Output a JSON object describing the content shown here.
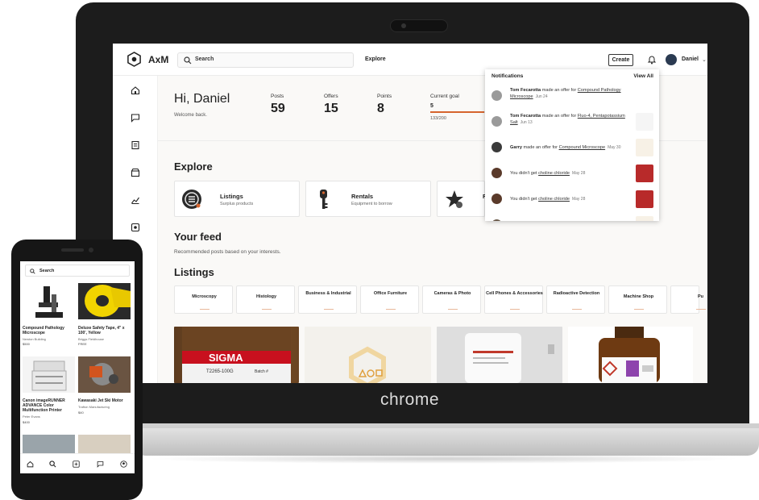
{
  "laptop": {
    "brand": "chrome",
    "app": {
      "logo_text": "AxM",
      "search_label": "Search",
      "nav_explore": "Explore",
      "create_label": "Create",
      "user_name": "Daniel",
      "greeting": "Hi, Daniel",
      "welcome": "Welcome back.",
      "stats": [
        {
          "label": "Posts",
          "value": "59"
        },
        {
          "label": "Offers",
          "value": "15"
        },
        {
          "label": "Points",
          "value": "8"
        }
      ],
      "goal": {
        "label": "Current goal",
        "value": "5",
        "progress_text": "133/200",
        "progress": 0.665
      },
      "explore_heading": "Explore",
      "explore_cards": [
        {
          "title": "Listings",
          "subtitle": "Surplus products"
        },
        {
          "title": "Rentals",
          "subtitle": "Equipment to borrow"
        },
        {
          "title": "R",
          "subtitle": ""
        }
      ],
      "feed_heading": "Your feed",
      "feed_sub": "Recommended posts based on your interests.",
      "listings_heading": "Listings",
      "categories": [
        "Microscopy",
        "Histology",
        "Business & Industrial",
        "Office Furniture",
        "Cameras & Photo",
        "Cell Phones & Accessories",
        "Radioactive Detection",
        "Machine Shop",
        "Pu"
      ],
      "photo_labels": {
        "sigma": "SIGMA",
        "sigma_sub": "T2265-100G",
        "sigma_batch": "Batch #"
      },
      "notifications": {
        "title": "Notifications",
        "view_all": "View All",
        "items": [
          {
            "actor": "Tom Fecarotta",
            "action": "made an offer for",
            "target": "Compound Pathology Microscope",
            "date": "Jun 24"
          },
          {
            "actor": "Tom Fecarotta",
            "action": "made an offer for",
            "target": "Fluo-4, Pentapotassium Salt",
            "date": "Jun 13"
          },
          {
            "actor": "Garry",
            "action": "made an offer for",
            "target": "Compound Microscope",
            "date": "May 30"
          },
          {
            "actor": "",
            "action": "You didn't get",
            "target": "choline chloride",
            "date": "May 28"
          },
          {
            "actor": "",
            "action": "You didn't get",
            "target": "choline chloride",
            "date": "May 28"
          },
          {
            "actor": "Peter John Tucker",
            "action": "responded to your request",
            "target": "",
            "date": ""
          }
        ]
      }
    }
  },
  "phone": {
    "search_label": "Search",
    "listings": [
      {
        "title": "Compound Pathology Microscope",
        "location": "Newton Building",
        "price": "$500"
      },
      {
        "title": "Deluxe Safety Tape, 4\" x 100', Yellow",
        "location": "Briggs Fieldhouse",
        "price": "FREE"
      },
      {
        "title": "Canon imageRUNNER ADVANCE Color Multifunction Printer",
        "location": "Peter Evans",
        "price": "$400"
      },
      {
        "title": "Kawasaki Jet Ski Motor",
        "location": "Trafton Manufacturing",
        "price": "$40"
      }
    ]
  },
  "colors": {
    "accent": "#d6652e",
    "dark": "#1c1c1c",
    "navy": "#2b3b52"
  }
}
